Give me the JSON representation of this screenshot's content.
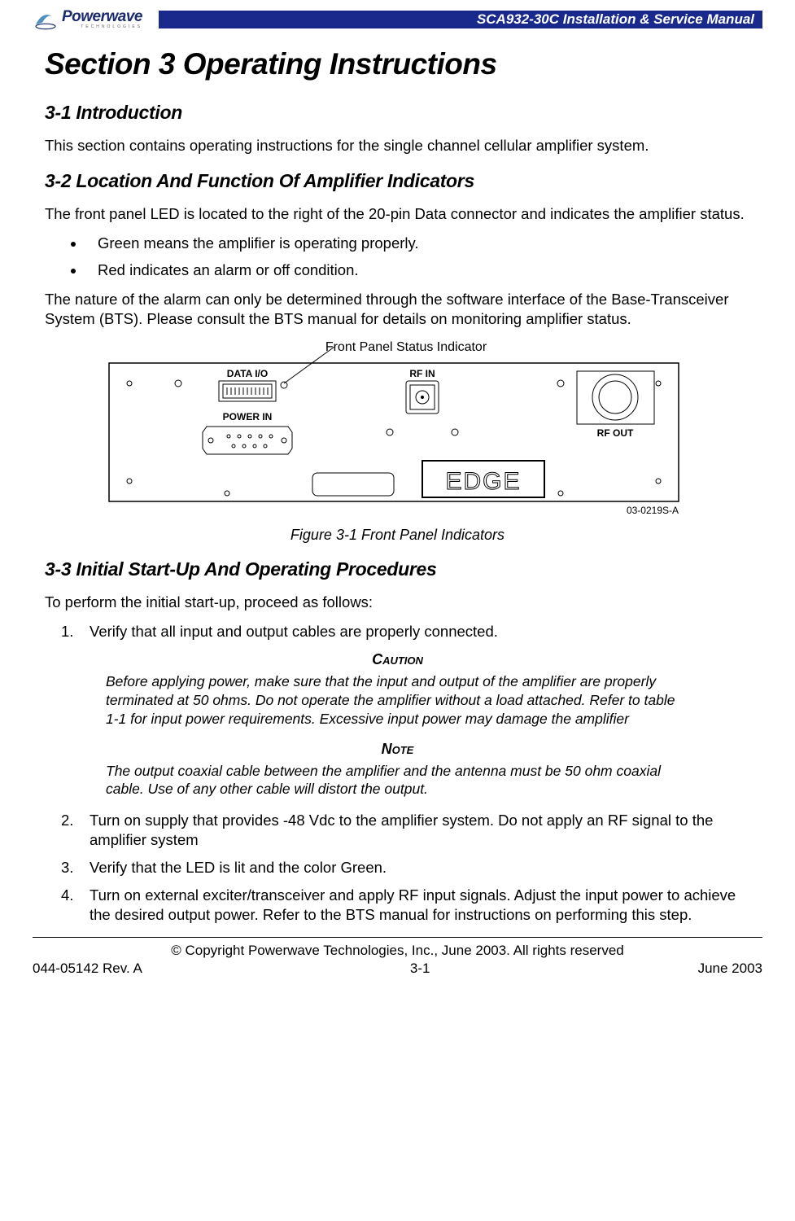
{
  "header": {
    "logo_text": "Powerwave",
    "logo_subtext": "TECHNOLOGIES",
    "document_title": "SCA932-30C Installation & Service Manual"
  },
  "section_title": "Section 3  Operating Instructions",
  "s31": {
    "heading": "3-1  Introduction",
    "p1": "This section contains operating instructions for the single channel cellular amplifier system."
  },
  "s32": {
    "heading": "3-2  Location And Function Of Amplifier Indicators",
    "p1": "The front panel LED is located to the right of the 20-pin Data connector and indicates the amplifier status.",
    "bullets": [
      "Green means the amplifier is operating properly.",
      "Red indicates an alarm or off condition."
    ],
    "p2": "The nature of the alarm can only be determined through the software interface of the Base-Transceiver System (BTS). Please consult the BTS manual for details on monitoring amplifier status."
  },
  "figure": {
    "callout": "Front Panel Status Indicator",
    "labels": {
      "data_io": "DATA I/O",
      "power_in": "POWER IN",
      "rf_in": "RF IN",
      "rf_out": "RF OUT",
      "edge": "EDGE"
    },
    "drawing_number": "03-0219S-A",
    "caption": "Figure 3-1   Front Panel Indicators"
  },
  "s33": {
    "heading": "3-3  Initial Start-Up And Operating Procedures",
    "p1": "To perform the initial start-up, proceed as follows:",
    "steps": {
      "s1": "Verify that all input and output cables are properly connected.",
      "s2": "Turn on supply that provides -48 Vdc to the amplifier system. Do not apply an RF signal to the amplifier system",
      "s3": "Verify that the LED is lit and the color Green.",
      "s4": "Turn on external exciter/transceiver and apply RF input signals. Adjust the input power to achieve the desired output power. Refer to the BTS manual for instructions on performing this step."
    },
    "caution": {
      "label": "Caution",
      "text": "Before applying power, make sure that the input and output of the amplifier are properly terminated at 50 ohms.  Do not operate the amplifier without a load attached.  Refer to table 1-1 for input power requirements.  Excessive input power may damage the amplifier"
    },
    "note": {
      "label": "Note",
      "text": "The output coaxial cable between the amplifier and the antenna must be 50 ohm coaxial cable.  Use of any other cable will distort the output."
    }
  },
  "footer": {
    "copyright": "© Copyright Powerwave Technologies, Inc., June 2003. All rights reserved",
    "doc_number": "044-05142 Rev. A",
    "page_number": "3-1",
    "date": "June 2003"
  }
}
